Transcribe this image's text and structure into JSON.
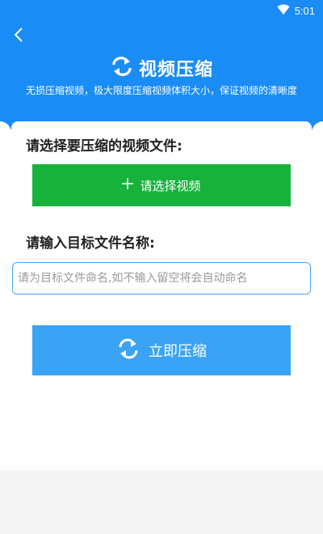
{
  "status_bar": {
    "time": "5:01",
    "wifi_icon": "wifi-icon"
  },
  "header": {
    "back_icon": "chevron-left-icon",
    "title_icon": "refresh-icon",
    "title": "视频压缩",
    "subtitle": "无损压缩视频，极大限度压缩视频体积大小，保证视频的清晰度"
  },
  "form": {
    "select_label": "请选择要压缩的视频文件:",
    "select_button": {
      "icon": "plus-icon",
      "label": "请选择视频"
    },
    "name_label": "请输入目标文件名称:",
    "name_input": {
      "value": "",
      "placeholder": "请为目标文件命名,如不输入留空将会自动命名"
    },
    "compress_button": {
      "icon": "refresh-icon",
      "label": "立即压缩"
    }
  },
  "colors": {
    "header_bg": "#1a8cf5",
    "select_button_bg": "#16b23c",
    "compress_button_bg": "#3aa3f5",
    "input_border": "#4aa3f0"
  }
}
